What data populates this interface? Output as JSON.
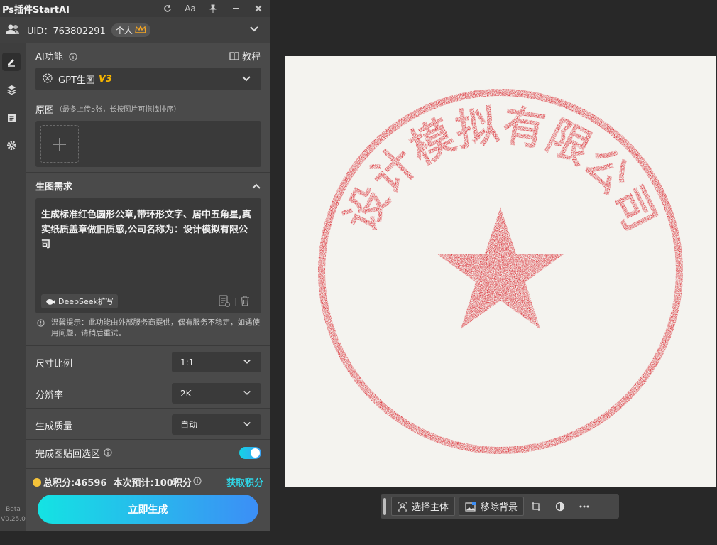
{
  "panel": {
    "title": "Ps插件StartAI",
    "uid_text": "UID：763802291",
    "plan_badge": "个人",
    "rail_version": [
      "Beta",
      "V0.25.0"
    ]
  },
  "ai_function": {
    "label": "AI功能",
    "tutorial": "教程",
    "model_name": "GPT生图",
    "model_version": "V3"
  },
  "source": {
    "label": "原图",
    "hint": "（最多上传5张，长按图片可拖拽排序）"
  },
  "prompt": {
    "label": "生图需求",
    "text": "生成标准红色圆形公章,带环形文字、居中五角星,真实纸质盖章做旧质感,公司名称为：设计模拟有限公司",
    "deepseek_label": "DeepSeek扩写"
  },
  "tip": "温馨提示：此功能由外部服务商提供，偶有服务不稳定，如遇使用问题，请稍后重试。",
  "settings": {
    "ratio_label": "尺寸比例",
    "ratio_value": "1:1",
    "resolution_label": "分辨率",
    "resolution_value": "2K",
    "quality_label": "生成质量",
    "quality_value": "自动",
    "paste_back_label": "完成图贴回选区",
    "paste_back_on": true
  },
  "points": {
    "summary": "总积分:46596  本次预计:100积分",
    "get_points": "获取积分"
  },
  "generate_label": "立即生成",
  "stamp": {
    "ring_text": "设计模拟有限公司",
    "color": "#d92028"
  },
  "toolbar": {
    "select_subject": "选择主体",
    "remove_bg": "移除背景"
  },
  "colors": {
    "accent": "#2fd6e6",
    "version_tag": "#f5b400"
  }
}
